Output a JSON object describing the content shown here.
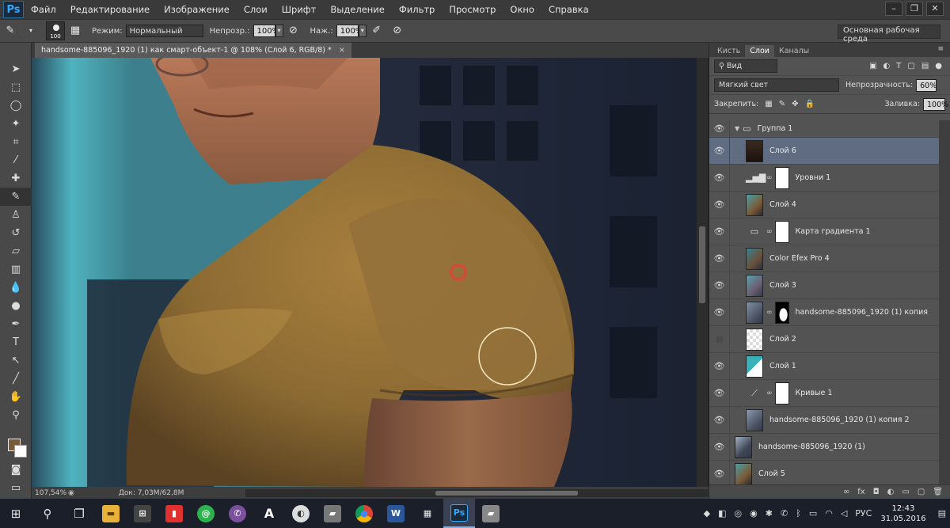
{
  "app": {
    "logo": "Ps",
    "menu": [
      "Файл",
      "Редактирование",
      "Изображение",
      "Слои",
      "Шрифт",
      "Выделение",
      "Фильтр",
      "Просмотр",
      "Окно",
      "Справка"
    ],
    "window_controls": [
      "–",
      "❐",
      "✕"
    ]
  },
  "options": {
    "brush_size": "100",
    "mode_label": "Режим:",
    "mode_value": "Нормальный",
    "opacity_label": "Непрозр.:",
    "opacity_value": "100%",
    "flow_label": "Наж.:",
    "flow_value": "100%",
    "workspace": "Основная рабочая среда"
  },
  "document": {
    "tab_title": "handsome-885096_1920 (1) как смарт-объект-1 @ 108% (Слой 6, RGB/8) *",
    "close": "×"
  },
  "status": {
    "zoom": "107,54%",
    "doc_size": "Док: 7,03M/62,8M"
  },
  "colors": {
    "foreground": "#7a5a36",
    "background": "#ffffff",
    "selection": "#5f6c82"
  },
  "panel": {
    "tabs": [
      "Кисть",
      "Слои",
      "Каналы"
    ],
    "active_tab": "Слои",
    "filter_kind": "Вид",
    "blend_mode": "Мягкий свет",
    "opacity_label": "Непрозрачность:",
    "opacity_value": "60%",
    "lock_label": "Закрепить:",
    "fill_label": "Заливка:",
    "fill_value": "100%",
    "layers": [
      {
        "name": "Группа 1",
        "type": "group"
      },
      {
        "name": "Слой 6",
        "type": "pixel",
        "selected": true
      },
      {
        "name": "Уровни 1",
        "type": "adjustment",
        "icon": "levels-icon"
      },
      {
        "name": "Слой 4",
        "type": "pixel"
      },
      {
        "name": "Карта градиента 1",
        "type": "adjustment",
        "icon": "gradient-map-icon"
      },
      {
        "name": "Color Efex Pro 4",
        "type": "pixel"
      },
      {
        "name": "Слой 3",
        "type": "pixel"
      },
      {
        "name": "handsome-885096_1920 (1) копия",
        "type": "masked"
      },
      {
        "name": "Слой 2",
        "type": "pixel",
        "hidden": true
      },
      {
        "name": "Слой 1",
        "type": "pixel"
      },
      {
        "name": "Кривые 1",
        "type": "adjustment",
        "icon": "curves-icon"
      },
      {
        "name": "handsome-885096_1920 (1) копия 2",
        "type": "pixel"
      },
      {
        "name": "handsome-885096_1920 (1)",
        "type": "pixel"
      },
      {
        "name": "Слой 5",
        "type": "pixel"
      }
    ]
  },
  "taskbar": {
    "language": "РУС",
    "time": "12:43",
    "date": "31.05.2016"
  }
}
